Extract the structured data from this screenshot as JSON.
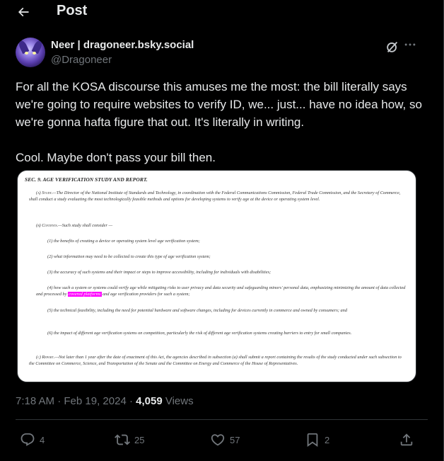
{
  "header": {
    "title": "Post"
  },
  "author": {
    "display_name": "Neer | dragoneer.bsky.social",
    "handle": "@Dragoneer"
  },
  "tweet": {
    "line1": "For all the KOSA discourse this amuses me the most: the bill literally says we're going to require websites to verify ID, we... just... have no idea how, so we're gonna hafta figure that out. It's literally in writing.",
    "line2": "Cool. Maybe don't pass your bill then."
  },
  "document": {
    "heading": "SEC. 9. AGE VERIFICATION STUDY AND REPORT.",
    "a_label": "(a) Study.",
    "a_text": "—The Director of the National Institute of Standards and Technology, in coordination with the Federal Communications Commission, Federal Trade Commission, and the Secretary of Commerce, shall conduct a study evaluating the most technologically feasible methods and options for developing systems to verify age at the device or operating system level.",
    "b_label": "(b) Contents.",
    "b_text": "—Such study shall consider —",
    "item1": "(1) the benefits of creating a device or operating system level age verification system;",
    "item2": "(2) what information may need to be collected to create this type of age verification system;",
    "item3": "(3) the accuracy of such systems and their impact or steps to improve accessibility, including for individuals with disabilities;",
    "item4_pre": "(4) how such a system or systems could verify age while mitigating risks to user privacy and data security and safeguarding minors' personal data, emphasizing minimizing the amount of data collected and processed by",
    "item4_highlight": "covered platforms",
    "item4_post": "and age verification providers for such a system;",
    "item5": "(5) the technical feasibility, including the need for potential hardware and software changes, including for devices currently in commerce and owned by consumers; and",
    "item6": "(6) the impact of different age verification systems on competition, particularly the risk of different age verification systems creating barriers to entry for small companies.",
    "c_label": "(c) Report.",
    "c_text": "—Not later than 1 year after the date of enactment of this Act, the agencies described in subsection (a) shall submit a report containing the results of the study conducted under such subsection to the Committee on Commerce, Science, and Transportation of the Senate and the Committee on Energy and Commerce of the House of Representatives."
  },
  "meta": {
    "time": "7:18 AM",
    "separator": "·",
    "date": "Feb 19, 2024",
    "views_count": "4,059",
    "views_label": "Views"
  },
  "actions": {
    "replies": "4",
    "reposts": "25",
    "likes": "57",
    "bookmarks": "2"
  },
  "colors": {
    "background": "#000000",
    "text": "#e7e9ea",
    "secondary": "#71767b",
    "border": "#2f3336",
    "highlight": "#ff00ff"
  }
}
